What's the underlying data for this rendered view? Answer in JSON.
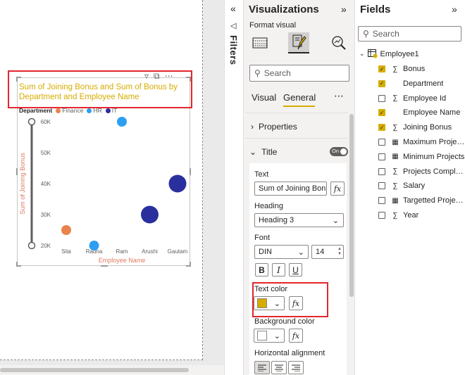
{
  "visual_header": {
    "filter_icon": "filter-icon",
    "focus_icon": "focus-mode-icon",
    "more_icon": "more-options-icon"
  },
  "chart_data": {
    "type": "scatter",
    "title": "Sum of Joining Bonus and Sum of Bonus by Department and Employee Name",
    "title_color": "#d6ac00",
    "xlabel": "Employee Name",
    "ylabel": "Sum of Joining Bonus",
    "categories": [
      "Sita",
      "Radha",
      "Ram",
      "Arushi",
      "Gautam"
    ],
    "yticks": [
      "60K",
      "50K",
      "40K",
      "30K",
      "20K"
    ],
    "ylim": [
      20000,
      60000
    ],
    "legend": {
      "title": "Department",
      "placement": "top-left",
      "items": [
        {
          "name": "Finance",
          "color": "#e8834e"
        },
        {
          "name": "HR",
          "color": "#2d9ff3"
        },
        {
          "name": "IT",
          "color": "#2a2f9e"
        }
      ]
    },
    "points": [
      {
        "x": "Sita",
        "y": 25000,
        "department": "Finance",
        "size": 2
      },
      {
        "x": "Radha",
        "y": 20000,
        "department": "HR",
        "size": 2
      },
      {
        "x": "Ram",
        "y": 60000,
        "department": "HR",
        "size": 2
      },
      {
        "x": "Arushi",
        "y": 30000,
        "department": "IT",
        "size": 5
      },
      {
        "x": "Gautam",
        "y": 40000,
        "department": "IT",
        "size": 5
      }
    ]
  },
  "filters": {
    "label": "Filters"
  },
  "visualizations": {
    "title": "Visualizations",
    "format_visual_label": "Format visual",
    "search_placeholder": "Search",
    "tabs": {
      "visual": "Visual",
      "general": "General"
    },
    "sections": {
      "properties": "Properties",
      "title": "Title",
      "title_toggle": "On"
    },
    "title_card": {
      "text_label": "Text",
      "text_value": "Sum of Joining Bonu",
      "heading_label": "Heading",
      "heading_value": "Heading 3",
      "font_label": "Font",
      "font_value": "DIN",
      "font_size": "14",
      "bold": "B",
      "italic": "I",
      "underline": "U",
      "text_color_label": "Text color",
      "text_color": "#d6ac00",
      "background_color_label": "Background color",
      "background_color": "#ffffff",
      "horizontal_alignment_label": "Horizontal alignment",
      "fx": "fx"
    }
  },
  "fields": {
    "title": "Fields",
    "search_placeholder": "Search",
    "table": "Employee1",
    "items": [
      {
        "name": "Bonus",
        "checked": true,
        "icon": "sigma"
      },
      {
        "name": "Department",
        "checked": true,
        "icon": "none"
      },
      {
        "name": "Employee Id",
        "checked": false,
        "icon": "sigma"
      },
      {
        "name": "Employee Name",
        "checked": true,
        "icon": "none"
      },
      {
        "name": "Joining Bonus",
        "checked": true,
        "icon": "sigma"
      },
      {
        "name": "Maximum Projects",
        "checked": false,
        "icon": "calculator"
      },
      {
        "name": "Minimum Projects",
        "checked": false,
        "icon": "calculator"
      },
      {
        "name": "Projects Complet...",
        "checked": false,
        "icon": "sigma"
      },
      {
        "name": "Salary",
        "checked": false,
        "icon": "sigma"
      },
      {
        "name": "Targetted Projects",
        "checked": false,
        "icon": "calculator"
      },
      {
        "name": "Year",
        "checked": false,
        "icon": "sigma"
      }
    ]
  }
}
